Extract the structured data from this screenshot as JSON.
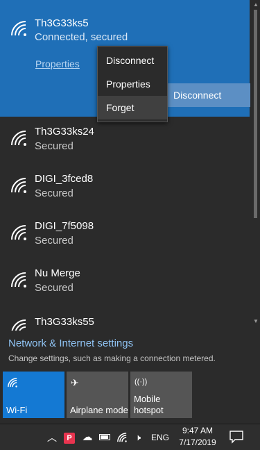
{
  "connected_network": {
    "name": "Th3G33ks5",
    "status": "Connected, secured",
    "properties_link": "Properties",
    "disconnect_button": "Disconnect"
  },
  "context_menu": {
    "items": [
      {
        "label": "Disconnect"
      },
      {
        "label": "Properties"
      },
      {
        "label": "Forget"
      }
    ]
  },
  "networks": [
    {
      "name": "Th3G33ks24",
      "status": "Secured"
    },
    {
      "name": "DIGI_3fced8",
      "status": "Secured"
    },
    {
      "name": "DIGI_7f5098",
      "status": "Secured"
    },
    {
      "name": "Nu Merge",
      "status": "Secured"
    },
    {
      "name": "Th3G33ks55",
      "status": ""
    }
  ],
  "settings": {
    "title": "Network & Internet settings",
    "subtitle": "Change settings, such as making a connection metered."
  },
  "quick_actions": [
    {
      "label": "Wi-Fi",
      "icon": "wifi-icon",
      "active": true
    },
    {
      "label": "Airplane mode",
      "icon": "airplane-icon",
      "active": false
    },
    {
      "label_line1": "Mobile",
      "label_line2": "hotspot",
      "icon": "hotspot-icon",
      "active": false
    }
  ],
  "taskbar": {
    "language": "ENG",
    "time": "9:47 AM",
    "date": "7/17/2019"
  },
  "colors": {
    "accent": "#1479d3",
    "connected_bg": "#1f6fb7",
    "flyout_bg": "#2b2b2b",
    "link": "#8fc3f3"
  }
}
